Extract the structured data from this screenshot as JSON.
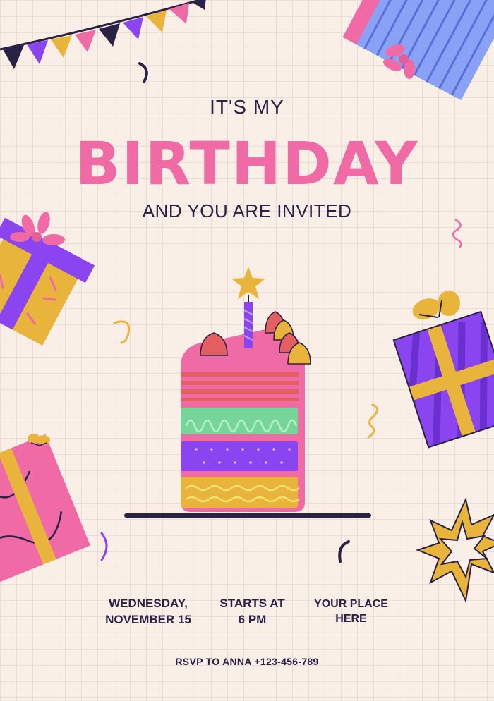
{
  "heading": {
    "top": "IT'S MY",
    "main": "BIRTHDAY",
    "sub": "AND YOU ARE INVITED"
  },
  "details": {
    "day": "WEDNESDAY,",
    "date": "NOVEMBER 15",
    "starts_label": "STARTS AT",
    "time": "6 PM",
    "place_line1": "YOUR PLACE",
    "place_line2": "HERE"
  },
  "rsvp": "RSVP TO ANNA +123-456-789",
  "colors": {
    "background": "#f9efe6",
    "pink": "#f06aa6",
    "purple": "#8b45f0",
    "yellow": "#e9b43c",
    "navy": "#2a2244",
    "blue": "#8aa2f5"
  }
}
